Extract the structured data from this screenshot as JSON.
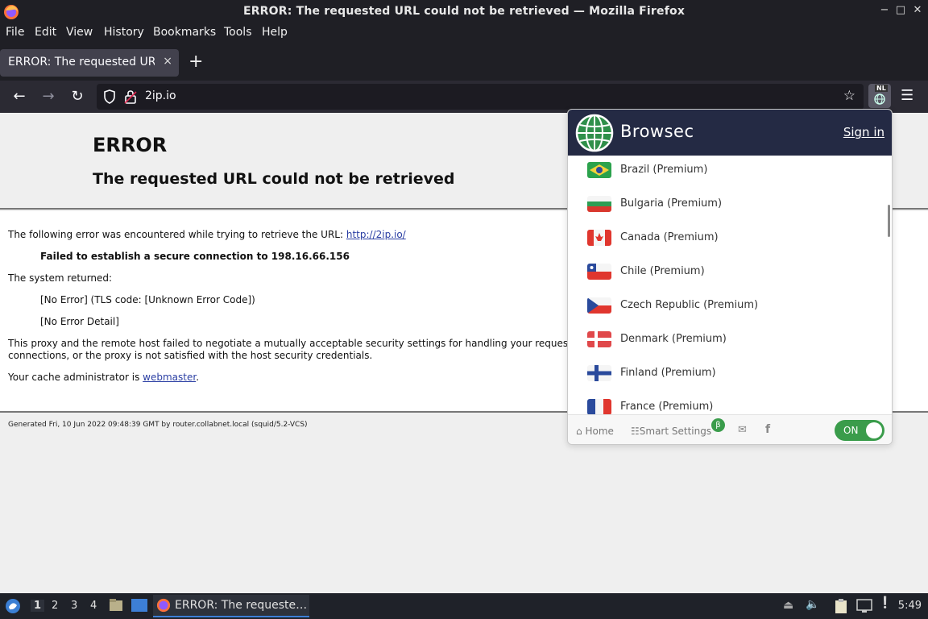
{
  "window": {
    "title": "ERROR: The requested URL could not be retrieved — Mozilla Firefox",
    "minimize": "−",
    "maximize": "□",
    "close": "✕"
  },
  "menu": [
    "File",
    "Edit",
    "View",
    "History",
    "Bookmarks",
    "Tools",
    "Help"
  ],
  "tab": {
    "title": "ERROR: The requested URL could not be retrieved",
    "close": "×",
    "new_tab": "+"
  },
  "nav": {
    "url": "2ip.io",
    "ext_badge": "NL"
  },
  "page": {
    "heading": "ERROR",
    "subheading": "The requested URL could not be retrieved",
    "line1_prefix": "The following error was encountered while trying to retrieve the URL: ",
    "line1_link": "http://2ip.io/",
    "line2": "Failed to establish a secure connection to 198.16.66.156",
    "line3": "The system returned:",
    "line4": "[No Error] (TLS code: [Unknown Error Code])",
    "line5": "[No Error Detail]",
    "line6": "This proxy and the remote host failed to negotiate a mutually acceptable security settings for handling your reques",
    "line7": "connections, or the proxy is not satisfied with the host security credentials.",
    "line8_prefix": "Your cache administrator is ",
    "line8_link": "webmaster",
    "line8_suffix": ".",
    "footer": "Generated Fri, 10 Jun 2022 09:48:39 GMT by router.collabnet.local (squid/5.2-VCS)"
  },
  "browsec": {
    "name": "Browsec",
    "sign_in": "Sign in",
    "countries": [
      {
        "name": "Brazil (Premium)",
        "flag": "brazil-flag"
      },
      {
        "name": "Bulgaria (Premium)",
        "flag": "bulgaria-flag"
      },
      {
        "name": "Canada (Premium)",
        "flag": "canada-flag"
      },
      {
        "name": "Chile (Premium)",
        "flag": "chile-flag"
      },
      {
        "name": "Czech Republic (Premium)",
        "flag": "czech-flag"
      },
      {
        "name": "Denmark (Premium)",
        "flag": "denmark-flag"
      },
      {
        "name": "Finland (Premium)",
        "flag": "finland-flag"
      },
      {
        "name": "France (Premium)",
        "flag": "france-flag"
      }
    ],
    "footer": {
      "home": "Home",
      "smart_settings": "Smart Settings",
      "beta": "β",
      "toggle": "ON"
    }
  },
  "taskbar": {
    "workspaces": [
      "1",
      "2",
      "3",
      "4"
    ],
    "task_title": "ERROR: The requeste…",
    "clock": "5:49"
  }
}
